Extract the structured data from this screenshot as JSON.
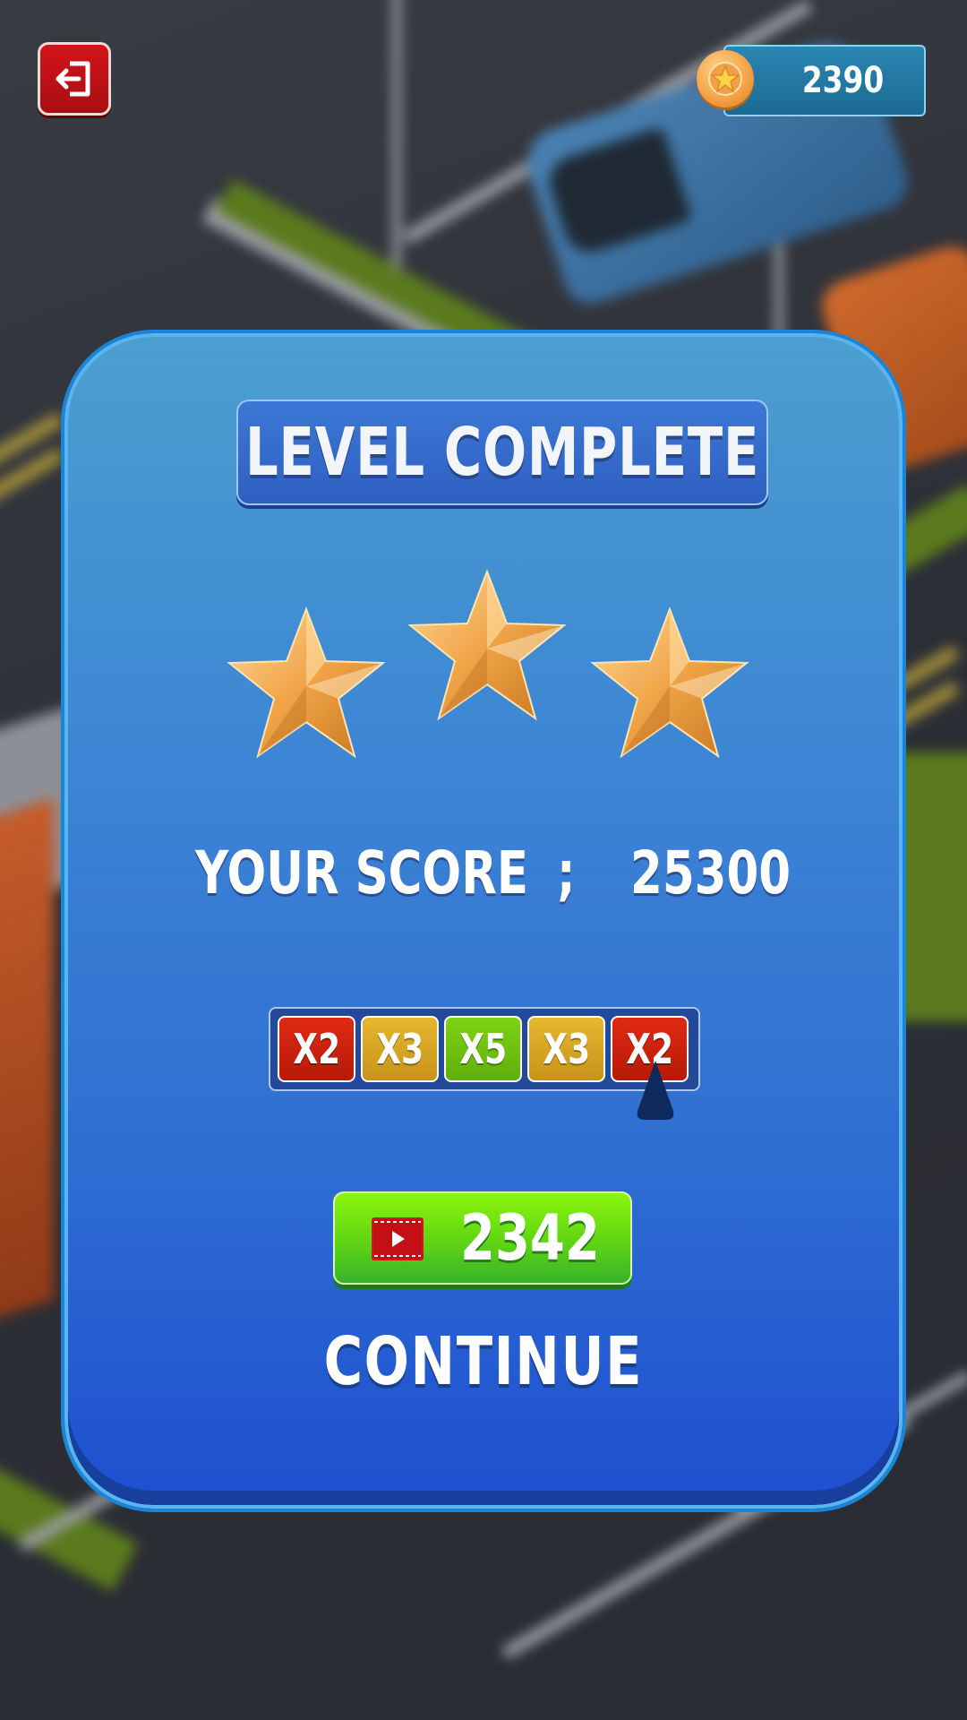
{
  "hud": {
    "coins": "2390",
    "exit_icon": "exit-icon",
    "coin_icon": "coin-star-icon"
  },
  "card": {
    "title": "LEVEL COMPLETE",
    "stars_earned": 3,
    "stars_total": 3,
    "score_label": "YOUR SCORE",
    "score_separator": ";",
    "score_value": "25300",
    "multipliers": [
      "X2",
      "X3",
      "X5",
      "X3",
      "X2"
    ],
    "multiplier_colors": [
      "#d62010",
      "#d9a825",
      "#6cc10f",
      "#d9a825",
      "#d62010"
    ],
    "selected_multiplier": "X2",
    "watch_ad_value": "2342",
    "watch_ad_icon": "video-ad-icon",
    "continue_label": "CONTINUE"
  }
}
